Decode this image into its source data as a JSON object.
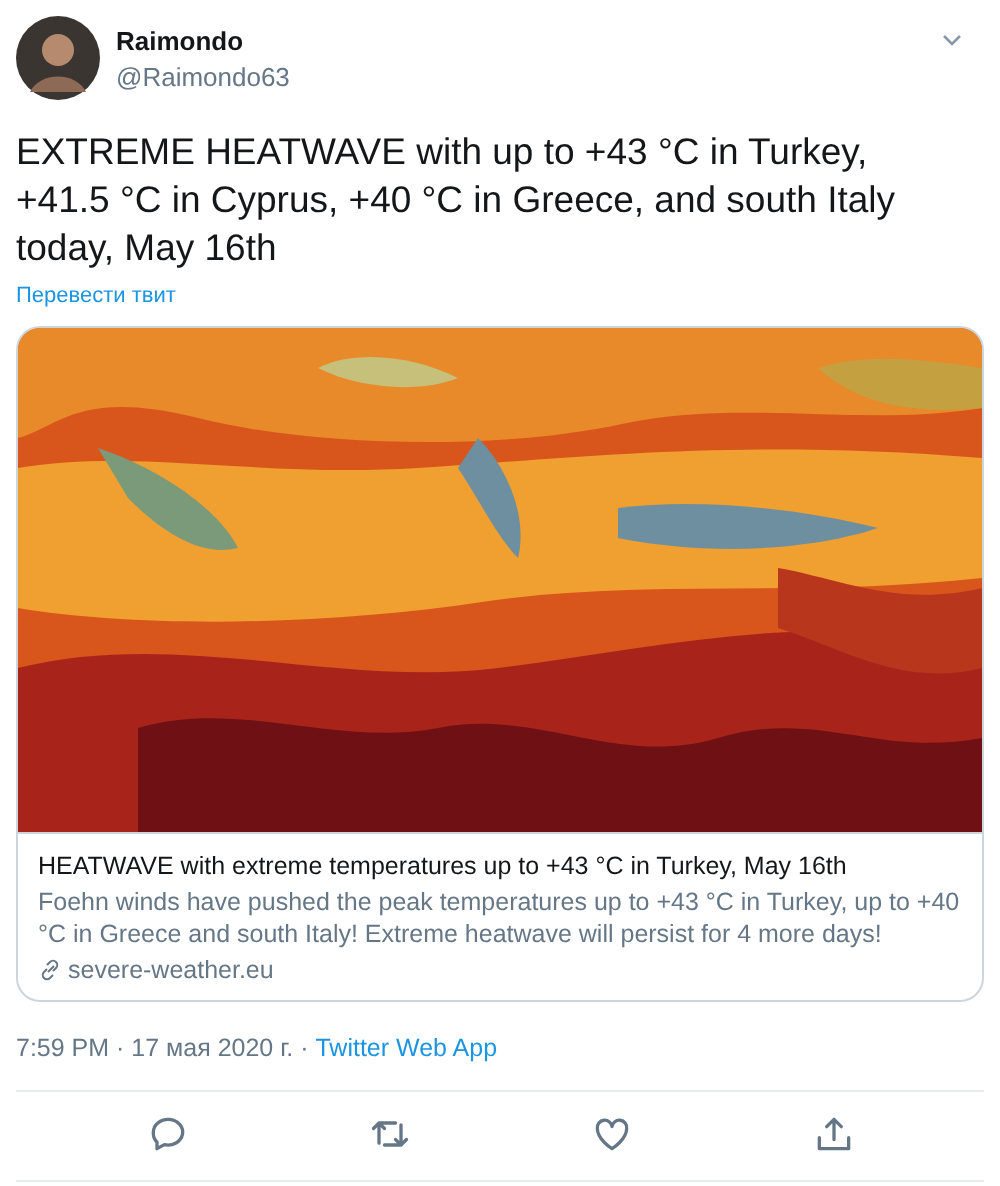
{
  "author": {
    "name": "Raimondo",
    "handle": "@Raimondo63"
  },
  "text": "EXTREME HEATWAVE with up to +43 °C in Turkey, +41.5 °C in Cyprus, +40 °C in Greece, and south Italy today, May 16th",
  "translate_link": "Перевести твит",
  "card": {
    "title": "HEATWAVE with extreme temperatures up to +43 °C in Turkey, May 16th",
    "description": "Foehn winds have pushed the peak temperatures up to +43 °C in Turkey, up to +40 °C in Greece and south Italy! Extreme heatwave will persist for 4 more days!",
    "domain": "severe-weather.eu"
  },
  "timestamp": "7:59 PM · 17 мая 2020 г. · ",
  "source": "Twitter Web App",
  "actions": [
    {
      "kind": "reply"
    },
    {
      "kind": "retweet"
    },
    {
      "kind": "like"
    },
    {
      "kind": "share"
    }
  ]
}
